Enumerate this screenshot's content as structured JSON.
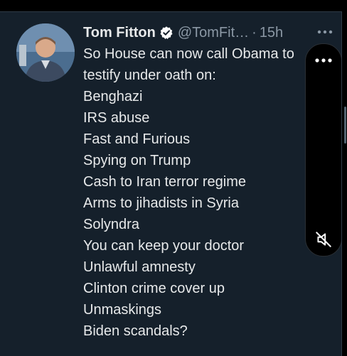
{
  "tweet": {
    "author": {
      "name": "Tom Fitton",
      "handle": "@TomFit…",
      "verified": true,
      "avatar_icon": "profile-photo"
    },
    "separator": "·",
    "timestamp": "15h",
    "more_icon": "more-horizontal-icon",
    "lines": [
      "So House can now call Obama to",
      "testify under oath on:",
      "Benghazi",
      "IRS abuse",
      "Fast and Furious",
      "Spying on Trump",
      "Cash to Iran terror regime",
      "Arms to jihadists in Syria",
      "Solyndra",
      "You can keep your doctor",
      "Unlawful amnesty",
      "Clinton crime cover up",
      "Unmaskings",
      "Biden scandals?"
    ]
  },
  "media_overlay": {
    "menu_icon": "more-horizontal-icon",
    "mute_icon": "muted-speaker-icon"
  },
  "colors": {
    "background": "#15202b",
    "text_primary": "#e7e9ea",
    "text_secondary": "#8b98a5",
    "verified_badge": "#ffffff"
  }
}
